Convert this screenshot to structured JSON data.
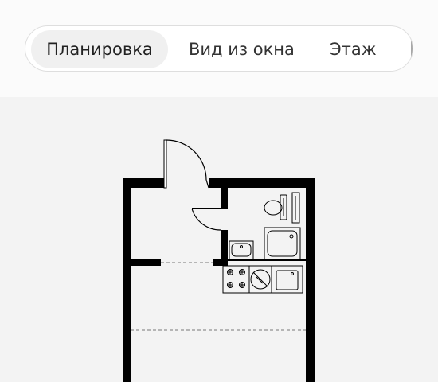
{
  "tabs": [
    {
      "label": "Планировка",
      "active": true
    },
    {
      "label": "Вид из окна",
      "active": false
    },
    {
      "label": "Этаж",
      "active": false
    }
  ],
  "colors": {
    "page_background": "#f3f3f3",
    "top_background": "#fbfbfb",
    "tabbar_background": "#ffffff",
    "active_tab_background": "#f0f0f0",
    "text": "#333333",
    "wall": "#000000"
  },
  "floor_plan": {
    "rooms": [
      "living-room",
      "hallway",
      "bathroom",
      "kitchen-zone"
    ],
    "fixtures": [
      "entrance-door",
      "bathroom-door",
      "toilet",
      "shower-tray",
      "washbasin",
      "cooktop",
      "washing-machine",
      "sink-cabinet"
    ]
  }
}
